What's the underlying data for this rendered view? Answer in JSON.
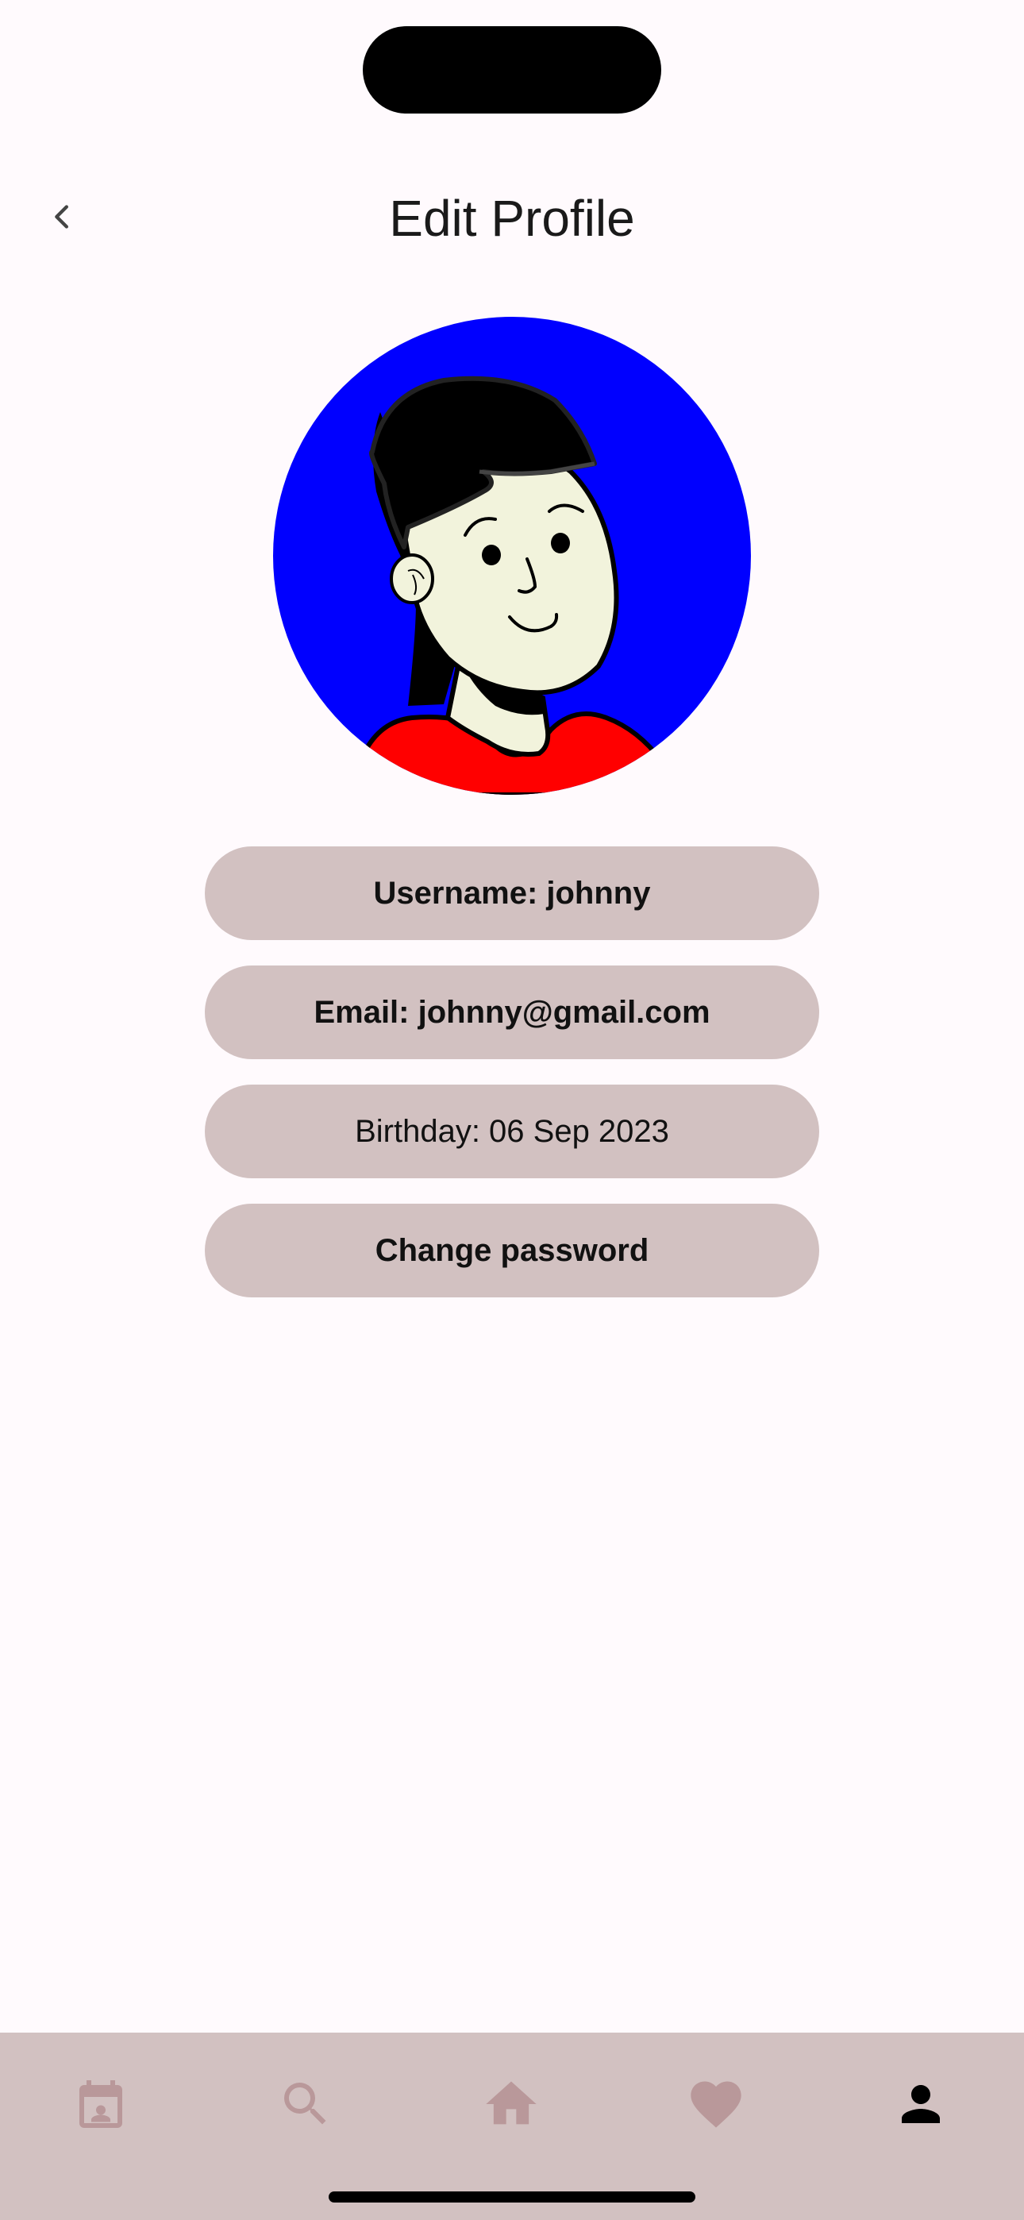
{
  "header": {
    "title": "Edit Profile"
  },
  "profile": {
    "username_label": "Username: johnny",
    "email_label": "Email: johnny@gmail.com",
    "birthday_label": "Birthday: 06 Sep 2023",
    "change_password_label": "Change password"
  },
  "avatar": {
    "background_color": "#0000FF",
    "shirt_color": "#FF0000",
    "skin_color": "#F2F3DC",
    "hair_color": "#000000"
  },
  "bottom_nav": {
    "items": [
      {
        "icon": "calendar-icon",
        "active": false
      },
      {
        "icon": "search-icon",
        "active": false
      },
      {
        "icon": "home-icon",
        "active": false
      },
      {
        "icon": "heart-icon",
        "active": false
      },
      {
        "icon": "person-icon",
        "active": true
      }
    ],
    "active_color": "#000000",
    "inactive_color": "#B9989A",
    "background_color": "#D2C1C1"
  },
  "theme": {
    "page_background": "#FFFAFD",
    "button_background": "#D2C1C1"
  }
}
